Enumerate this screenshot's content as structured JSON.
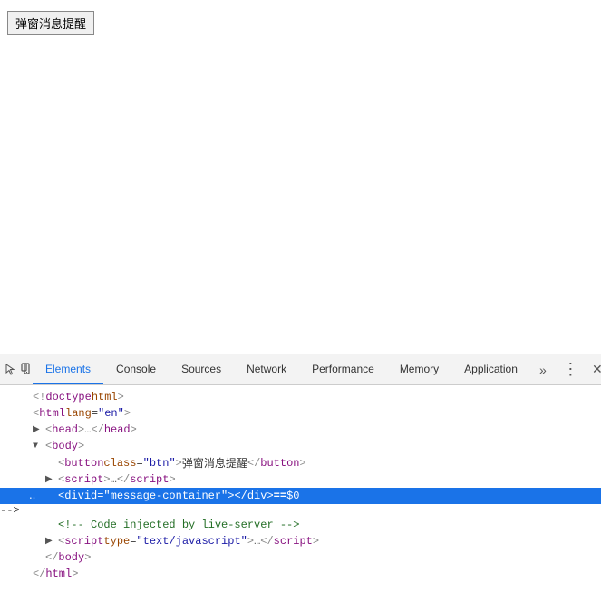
{
  "page": {
    "button_label": "弹窗消息提醒"
  },
  "devtools": {
    "tabs": [
      {
        "id": "elements",
        "label": "Elements",
        "active": true
      },
      {
        "id": "console",
        "label": "Console",
        "active": false
      },
      {
        "id": "sources",
        "label": "Sources",
        "active": false
      },
      {
        "id": "network",
        "label": "Network",
        "active": false
      },
      {
        "id": "performance",
        "label": "Performance",
        "active": false
      },
      {
        "id": "memory",
        "label": "Memory",
        "active": false
      },
      {
        "id": "application",
        "label": "Application",
        "active": false
      }
    ],
    "code_lines": [
      {
        "id": "line1",
        "indent": 0,
        "has_arrow": false,
        "arrow_open": false,
        "marker": "",
        "content": "doctype_html",
        "selected": false
      },
      {
        "id": "line2",
        "indent": 0,
        "has_arrow": false,
        "arrow_open": false,
        "marker": "",
        "content": "html_lang",
        "selected": false
      },
      {
        "id": "line3",
        "indent": 1,
        "has_arrow": true,
        "arrow_open": false,
        "marker": "",
        "content": "head_collapsed",
        "selected": false
      },
      {
        "id": "line4",
        "indent": 1,
        "has_arrow": true,
        "arrow_open": true,
        "marker": "",
        "content": "body_open",
        "selected": false
      },
      {
        "id": "line5",
        "indent": 2,
        "has_arrow": false,
        "arrow_open": false,
        "marker": "",
        "content": "button_btn",
        "selected": false
      },
      {
        "id": "line6",
        "indent": 2,
        "has_arrow": true,
        "arrow_open": false,
        "marker": "",
        "content": "script_collapsed",
        "selected": false
      },
      {
        "id": "line7",
        "indent": 2,
        "has_arrow": false,
        "arrow_open": false,
        "marker": "‥",
        "content": "div_message_container",
        "selected": true
      },
      {
        "id": "line8",
        "indent": 2,
        "has_arrow": false,
        "arrow_open": false,
        "marker": "",
        "content": "comment_live_server",
        "selected": false
      },
      {
        "id": "line9",
        "indent": 2,
        "has_arrow": true,
        "arrow_open": false,
        "marker": "",
        "content": "script_type",
        "selected": false
      },
      {
        "id": "line10",
        "indent": 1,
        "has_arrow": false,
        "arrow_open": false,
        "marker": "",
        "content": "body_close",
        "selected": false
      },
      {
        "id": "line11",
        "indent": 0,
        "has_arrow": false,
        "arrow_open": false,
        "marker": "",
        "content": "html_close",
        "selected": false
      }
    ]
  }
}
